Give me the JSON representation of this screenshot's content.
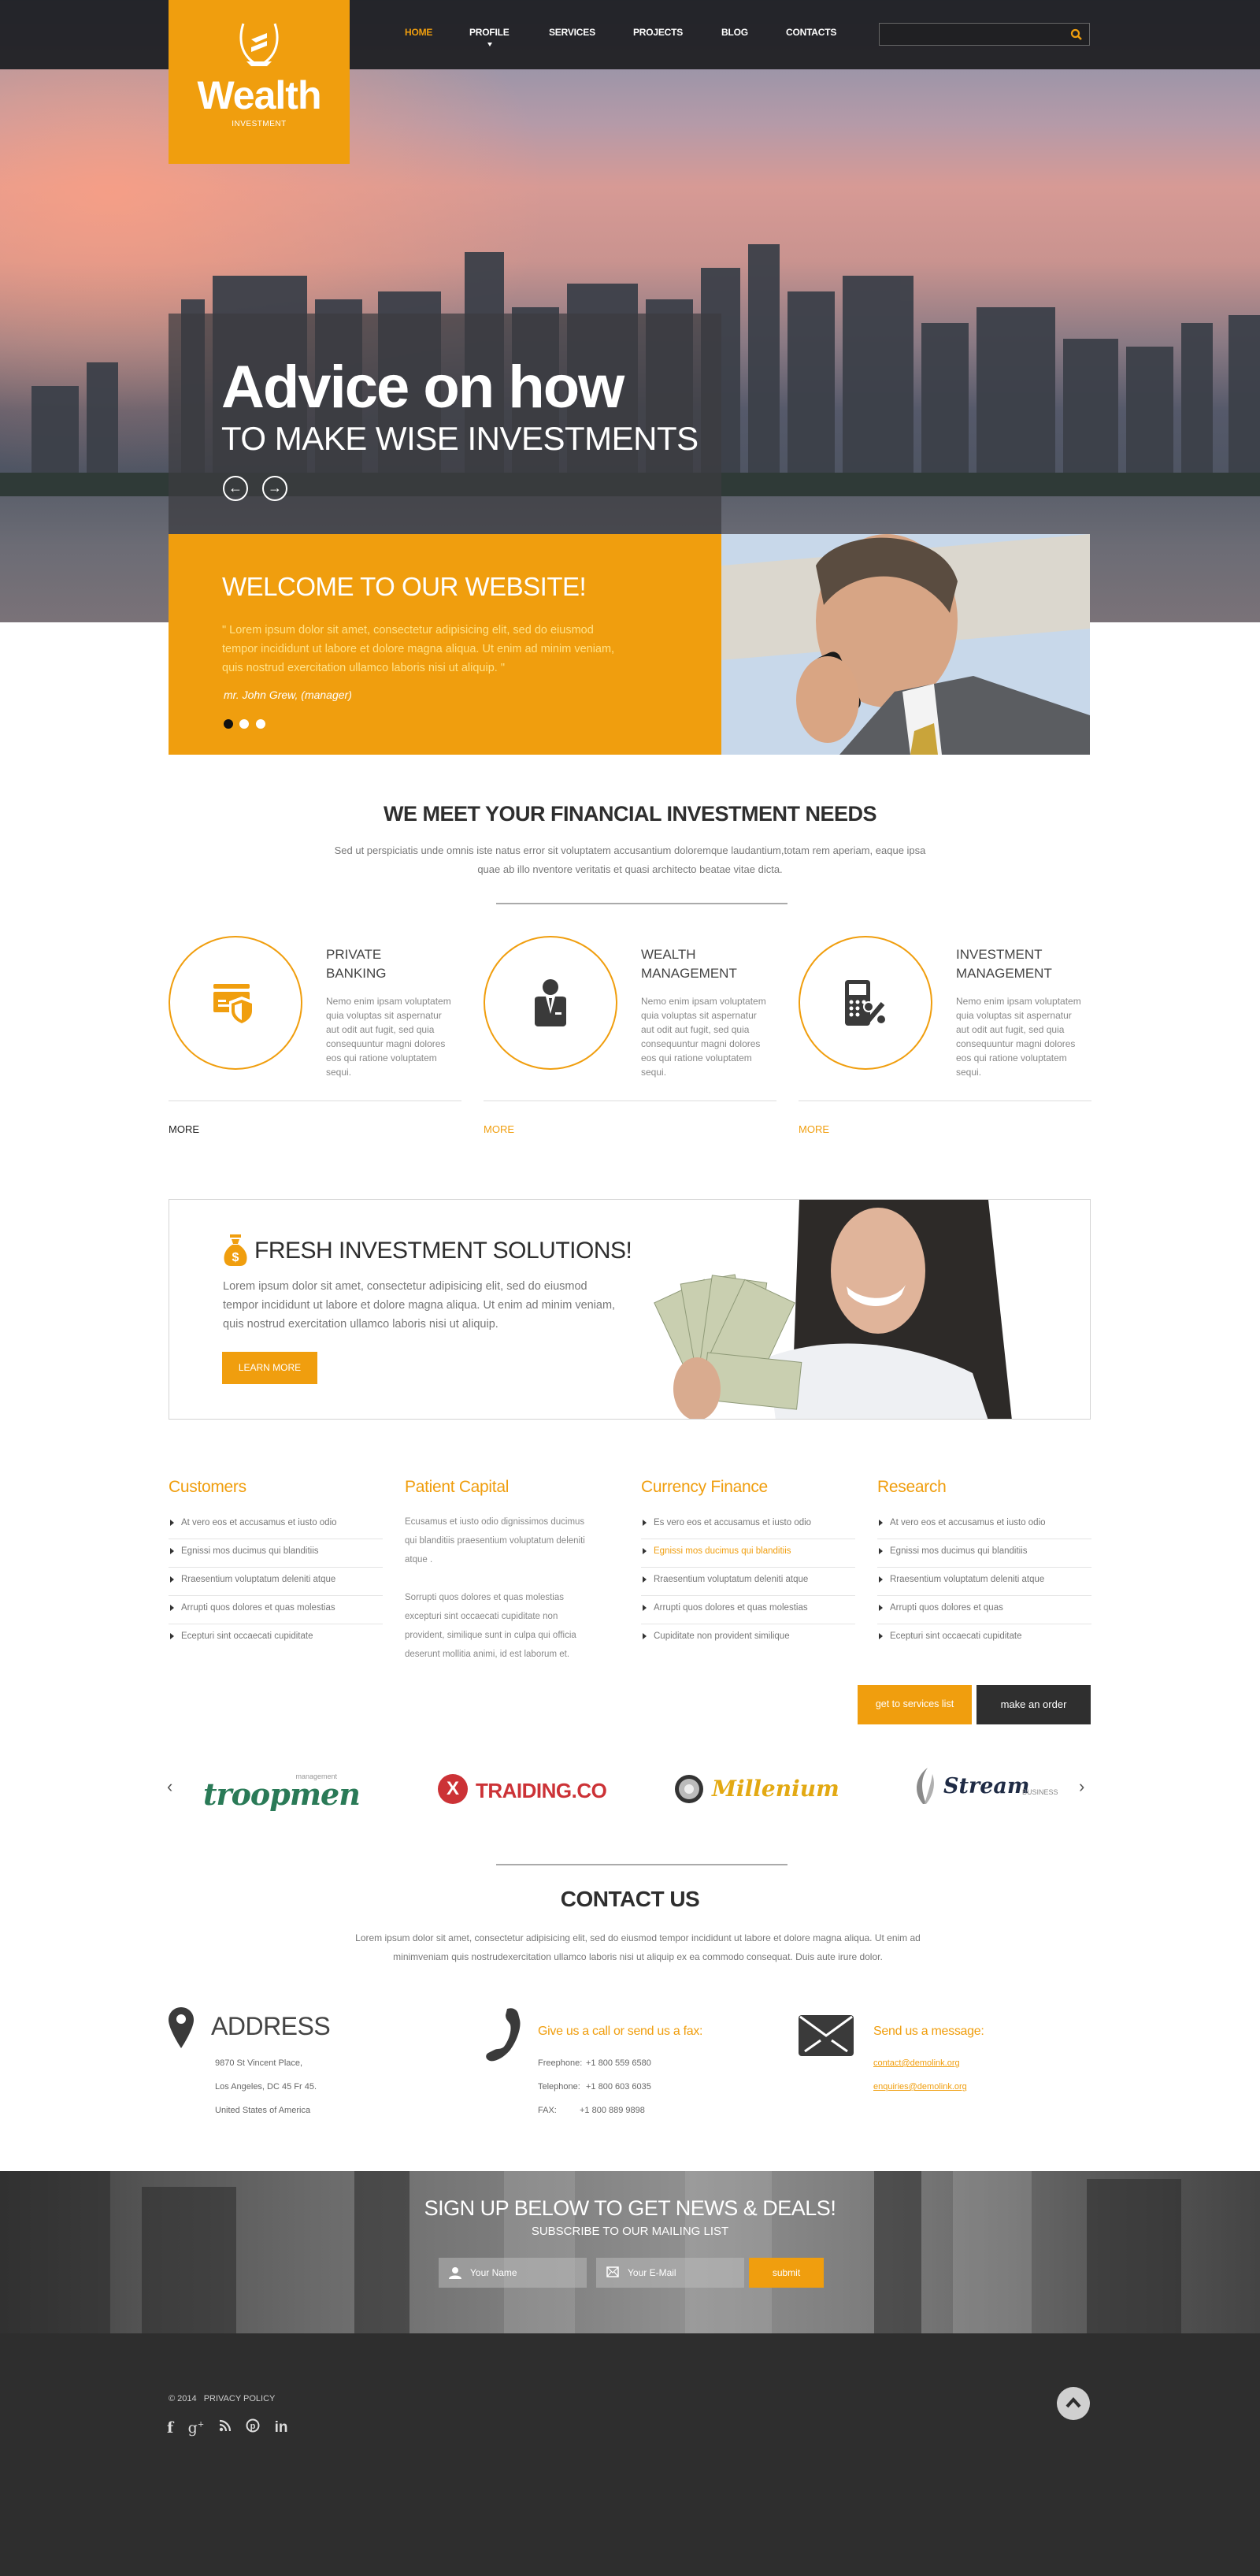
{
  "brand": {
    "name": "Wealth",
    "tagline": "INVESTMENT",
    "accent_color": "#f09e0e",
    "dark_color": "#2f2f2f"
  },
  "nav": {
    "items": [
      {
        "label": "HOME",
        "active": true
      },
      {
        "label": "PROFILE",
        "has_dropdown": true
      },
      {
        "label": "SERVICES"
      },
      {
        "label": "PROJECTS"
      },
      {
        "label": "BLOG"
      },
      {
        "label": "CONTACTS"
      }
    ],
    "search": {
      "placeholder": "",
      "value": "",
      "icon": "search-icon"
    }
  },
  "hero": {
    "title": "Advice on how",
    "subtitle": "TO MAKE WISE INVESTMENTS",
    "prev_icon": "arrow-left-icon",
    "next_icon": "arrow-right-icon"
  },
  "welcome": {
    "title": "WELCOME TO OUR WEBSITE!",
    "quote": "\"  Lorem ipsum dolor sit amet, consectetur adipisicing elit, sed do eiusmod tempor incididunt ut labore et dolore magna aliqua. Ut enim ad minim veniam, quis nostrud exercitation ullamco laboris nisi ut aliquip. \"",
    "author": "mr. John Grew, (manager)",
    "slides_total": 3,
    "slide_active": 1
  },
  "needs": {
    "title": "WE MEET YOUR FINANCIAL INVESTMENT NEEDS",
    "text": "Sed ut perspiciatis unde omnis iste natus error sit voluptatem accusantium doloremque laudantium,totam rem aperiam, eaque ipsa quae ab illo nventore veritatis et quasi architecto beatae vitae dicta."
  },
  "features": [
    {
      "title_line1": "PRIVATE",
      "title_line2": "BANKING",
      "icon": "card-shield-icon",
      "text": "Nemo enim ipsam voluptatem quia voluptas sit aspernatur aut odit aut fugit, sed quia consequuntur magni dolores eos qui ratione voluptatem sequi.",
      "more": "MORE",
      "more_active": false
    },
    {
      "title_line1": "WEALTH",
      "title_line2": "MANAGEMENT",
      "icon": "businessman-icon",
      "text": "Nemo enim ipsam voluptatem quia voluptas sit aspernatur aut odit aut fugit, sed quia consequuntur magni dolores eos qui ratione voluptatem sequi.",
      "more": "MORE",
      "more_active": true
    },
    {
      "title_line1": "INVESTMENT",
      "title_line2": "MANAGEMENT",
      "icon": "calculator-percent-icon",
      "text": "Nemo enim ipsam voluptatem quia voluptas sit aspernatur aut odit aut fugit, sed quia consequuntur magni dolores eos qui ratione voluptatem sequi.",
      "more": "MORE",
      "more_active": true
    }
  ],
  "fresh": {
    "title": "FRESH INVESTMENT SOLUTIONS!",
    "text": "Lorem ipsum dolor sit amet, consectetur adipisicing elit, sed do eiusmod tempor incididunt ut labore et dolore magna aliqua. Ut enim ad minim veniam, quis nostrud exercitation ullamco laboris nisi ut aliquip.",
    "button": "LEARN MORE",
    "icon": "money-bag-icon"
  },
  "columns": {
    "customers": {
      "title": "Customers",
      "items": [
        "At vero eos et accusamus et iusto odio",
        "Egnissi mos ducimus qui blanditiis",
        "Rraesentium voluptatum deleniti atque",
        "Arrupti quos dolores et quas molestias",
        "Ecepturi sint occaecati cupiditate"
      ]
    },
    "patient": {
      "title": "Patient Capital",
      "para1": "Ecusamus et iusto odio dignissimos ducimus qui blanditiis praesentium voluptatum deleniti atque .",
      "para2": "Sorrupti quos dolores et quas molestias excepturi sint occaecati cupiditate non provident, similique sunt in culpa qui officia deserunt mollitia animi, id est laborum et."
    },
    "currency": {
      "title": "Currency Finance",
      "items": [
        "Es vero eos et accusamus et iusto odio",
        "Egnissi mos ducimus qui blanditiis",
        "Rraesentium voluptatum deleniti atque",
        "Arrupti quos dolores et quas molestias",
        "Cupiditate non provident similique"
      ],
      "highlighted_index": 1
    },
    "research": {
      "title": "Research",
      "items": [
        "At vero eos et accusamus et iusto odio",
        "Egnissi mos ducimus qui blanditiis",
        "Rraesentium voluptatum deleniti atque",
        "Arrupti quos dolores et quas",
        "Ecepturi sint occaecati cupiditate"
      ]
    }
  },
  "actions": {
    "services_list": "get to services list",
    "make_order": "make an order"
  },
  "partners": {
    "logos": [
      {
        "name": "troopmen",
        "sub": "management",
        "color": "#2a7a57"
      },
      {
        "name": "TRAIDING.CO",
        "mark": "X",
        "color": "#cc3236"
      },
      {
        "name": "Millenium",
        "color": "#e3a913"
      },
      {
        "name": "Stream",
        "sub": "BUSINESS",
        "color": "#1f2b45"
      }
    ]
  },
  "contact": {
    "title": "CONTACT US",
    "text": "Lorem ipsum dolor sit amet, consectetur adipisicing elit, sed do eiusmod tempor incididunt ut labore et dolore magna aliqua. Ut enim ad minimveniam quis nostrudexercitation ullamco laboris nisi ut aliquip ex ea commodo consequat. Duis aute irure dolor.",
    "address": {
      "title": "ADDRESS",
      "lines": [
        "9870 St Vincent Place,",
        "Los Angeles, DC 45 Fr 45.",
        "United States of America"
      ]
    },
    "phone": {
      "title": "Give us a call or send us a fax:",
      "freephone_label": "Freephone:",
      "freephone": "+1 800 559 6580",
      "telephone_label": "Telephone:",
      "telephone": "+1 800 603 6035",
      "fax_label": "FAX:",
      "fax": "+1 800 889 9898"
    },
    "message": {
      "title": "Send us a message:",
      "emails": [
        "contact@demolink.org",
        "enquiries@demolink.org"
      ]
    }
  },
  "signup": {
    "title": "SIGN UP BELOW TO GET NEWS & DEALS!",
    "subtitle": "SUBSCRIBE TO OUR MAILING LIST",
    "name_placeholder": "Your Name",
    "email_placeholder": "Your E-Mail",
    "submit": "submit"
  },
  "footer": {
    "copyright": "© 2014",
    "privacy": "PRIVACY POLICY",
    "social": [
      {
        "name": "facebook",
        "glyph": "f"
      },
      {
        "name": "google-plus",
        "glyph": "g+"
      },
      {
        "name": "rss",
        "glyph": "rss"
      },
      {
        "name": "pinterest",
        "glyph": "p"
      },
      {
        "name": "linkedin",
        "glyph": "in"
      }
    ]
  }
}
